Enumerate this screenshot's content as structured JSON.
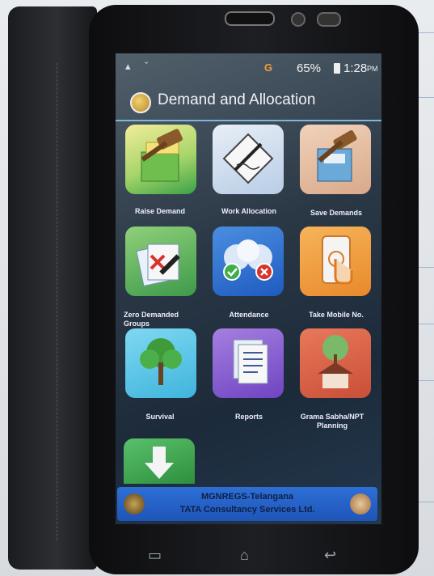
{
  "status": {
    "signal": "G",
    "battery_pct": "65%",
    "time": "1:28",
    "ampm": "PM"
  },
  "app": {
    "title": "Demand and Allocation"
  },
  "tiles": [
    {
      "label": "Raise Demand",
      "icon": "gavel-ballot-icon"
    },
    {
      "label": "Work Allocation",
      "icon": "signing-document-icon"
    },
    {
      "label": "Save Demands",
      "icon": "gavel-save-icon"
    },
    {
      "label": "Zero Demanded Groups",
      "icon": "zero-demand-icon"
    },
    {
      "label": "Attendance",
      "icon": "attendance-people-icon"
    },
    {
      "label": "Take Mobile No.",
      "icon": "mobile-touch-icon"
    },
    {
      "label": "Survival",
      "icon": "tree-icon"
    },
    {
      "label": "Reports",
      "icon": "reports-document-icon"
    },
    {
      "label": "Grama Sabha/NPT Planning",
      "icon": "tree-house-icon"
    },
    {
      "label": "",
      "icon": "download-arrow-icon"
    }
  ],
  "footer": {
    "line1": "MGNREGS-Telangana",
    "line2": "TATA Consultancy Services Ltd."
  },
  "navbar": {
    "recent": "▭",
    "home": "⌂",
    "back": "↩"
  }
}
